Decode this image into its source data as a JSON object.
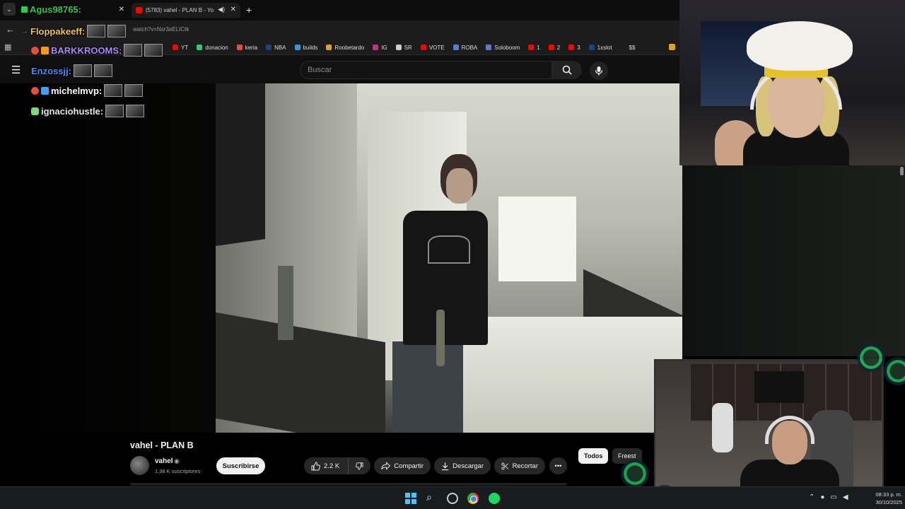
{
  "browser": {
    "tabs": [
      {
        "label": "",
        "active": false
      },
      {
        "label": "(5783) vahel - PLAN B - Yo",
        "active": true
      }
    ],
    "url": "watch?v=Nsr3aELICtk",
    "bookmarks": [
      {
        "label": "YT",
        "color": "#ff0000"
      },
      {
        "label": "donacion",
        "color": "#2ecc71"
      },
      {
        "label": "keria",
        "color": "#e74c3c"
      },
      {
        "label": "NBA",
        "color": "#1d428a"
      },
      {
        "label": "builds",
        "color": "#3498db"
      },
      {
        "label": "Roobetardo",
        "color": "#e0a020"
      },
      {
        "label": "IG",
        "color": "#c13584"
      },
      {
        "label": "SR",
        "color": "#cccccc"
      },
      {
        "label": "VOTE",
        "color": "#ff0000"
      },
      {
        "label": "ROBA",
        "color": "#5b7bd5"
      },
      {
        "label": "Soloboom",
        "color": "#5b7bd5"
      },
      {
        "label": "1",
        "color": "#ff0000"
      },
      {
        "label": "2",
        "color": "#ff0000"
      },
      {
        "label": "3",
        "color": "#ff0000"
      },
      {
        "label": "1xslot",
        "color": "#1d428a"
      },
      {
        "label": "$$",
        "color": "#1c1c1c"
      }
    ]
  },
  "youtube": {
    "search_placeholder": "Buscar",
    "video": {
      "title": "vahel - PLAN B",
      "channel": "vahel",
      "subscribers": "1.38 K suscriptores",
      "subscribe_label": "Suscribirse",
      "likes": "2.2 K",
      "share_label": "Compartir",
      "download_label": "Descargar",
      "clip_label": "Recortar"
    },
    "chips": [
      "Todos",
      "Freest"
    ]
  },
  "chat": [
    {
      "user": "Agus98765:",
      "color": "#2ecc40"
    },
    {
      "user": "Floppakeeff:",
      "color": "#f5c542"
    },
    {
      "user": "BARKKROOMS:",
      "color": "#b088ff"
    },
    {
      "user": "Enzossjj:",
      "color": "#4f8bff"
    },
    {
      "user": "michelmvp:",
      "color": "#ffffff"
    },
    {
      "user": "ignaciohustle:",
      "color": "#e6e6e6"
    }
  ],
  "taskbar": {
    "time": "08:33 p. m.",
    "date": "30/10/2025"
  }
}
